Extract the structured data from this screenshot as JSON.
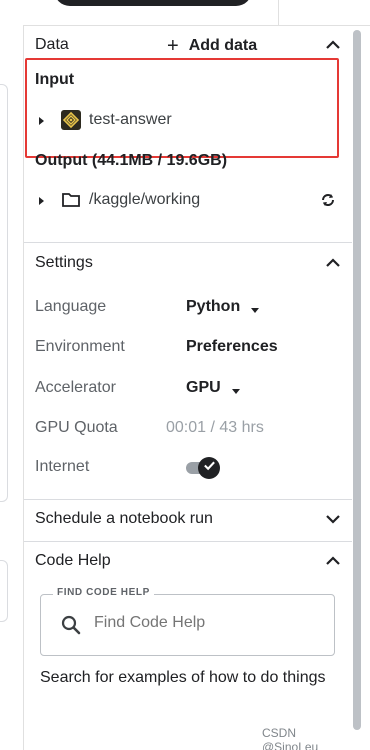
{
  "data_section": {
    "title": "Data",
    "add_label": "Add data",
    "input_heading": "Input",
    "input_item": "test-answer",
    "output_heading": "Output (44.1MB / 19.6GB)",
    "output_item": "/kaggle/working"
  },
  "settings": {
    "title": "Settings",
    "rows": [
      {
        "label": "Language",
        "value": "Python"
      },
      {
        "label": "Environment",
        "value": "Preferences"
      },
      {
        "label": "Accelerator",
        "value": "GPU"
      },
      {
        "label": "GPU Quota",
        "value": "00:01 / 43 hrs"
      },
      {
        "label": "Internet",
        "value": ""
      }
    ]
  },
  "schedule": {
    "title": "Schedule a notebook run"
  },
  "code_help": {
    "title": "Code Help",
    "field_label": "FIND CODE HELP",
    "placeholder": "Find Code Help",
    "description": "Search for examples of how to do things"
  },
  "watermark": "CSDN @SinoLeu",
  "colors": {
    "highlight_box": "#e53935",
    "toggle_on": "#202124",
    "muted_text": "#5f6368"
  }
}
